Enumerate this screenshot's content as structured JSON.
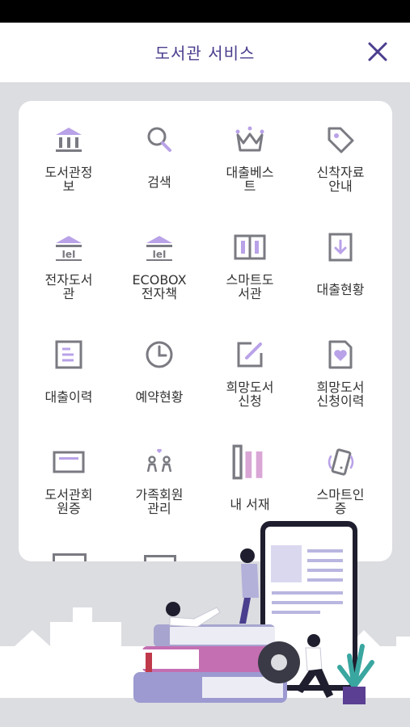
{
  "header": {
    "title": "도서관 서비스",
    "close_icon": "close-icon"
  },
  "colors": {
    "accent": "#4a3e8e",
    "icon_gray": "#7a7a82",
    "icon_purple": "#b9a2e8",
    "pink": "#d9a6d6"
  },
  "menu": [
    {
      "label": "도서관정\n보",
      "icon": "library-building-icon"
    },
    {
      "label": "검색",
      "icon": "search-icon"
    },
    {
      "label": "대출베스\n트",
      "icon": "crown-icon"
    },
    {
      "label": "신착자료\n안내",
      "icon": "tag-icon"
    },
    {
      "label": "전자도서\n관",
      "icon": "ebook-library-icon"
    },
    {
      "label": "ECOBOX\n전자책",
      "icon": "ecobox-icon"
    },
    {
      "label": "스마트도\n서관",
      "icon": "smart-library-icon"
    },
    {
      "label": "대출현황",
      "icon": "download-doc-icon"
    },
    {
      "label": "대출이력",
      "icon": "document-list-icon"
    },
    {
      "label": "예약현황",
      "icon": "clock-icon"
    },
    {
      "label": "희망도서\n신청",
      "icon": "edit-icon"
    },
    {
      "label": "희망도서\n신청이력",
      "icon": "heart-doc-icon"
    },
    {
      "label": "도서관회\n원증",
      "icon": "member-card-icon"
    },
    {
      "label": "가족회원\n관리",
      "icon": "family-icon"
    },
    {
      "label": "내 서재",
      "icon": "bookshelf-icon"
    },
    {
      "label": "스마트인\n증",
      "icon": "phone-auth-icon"
    }
  ]
}
